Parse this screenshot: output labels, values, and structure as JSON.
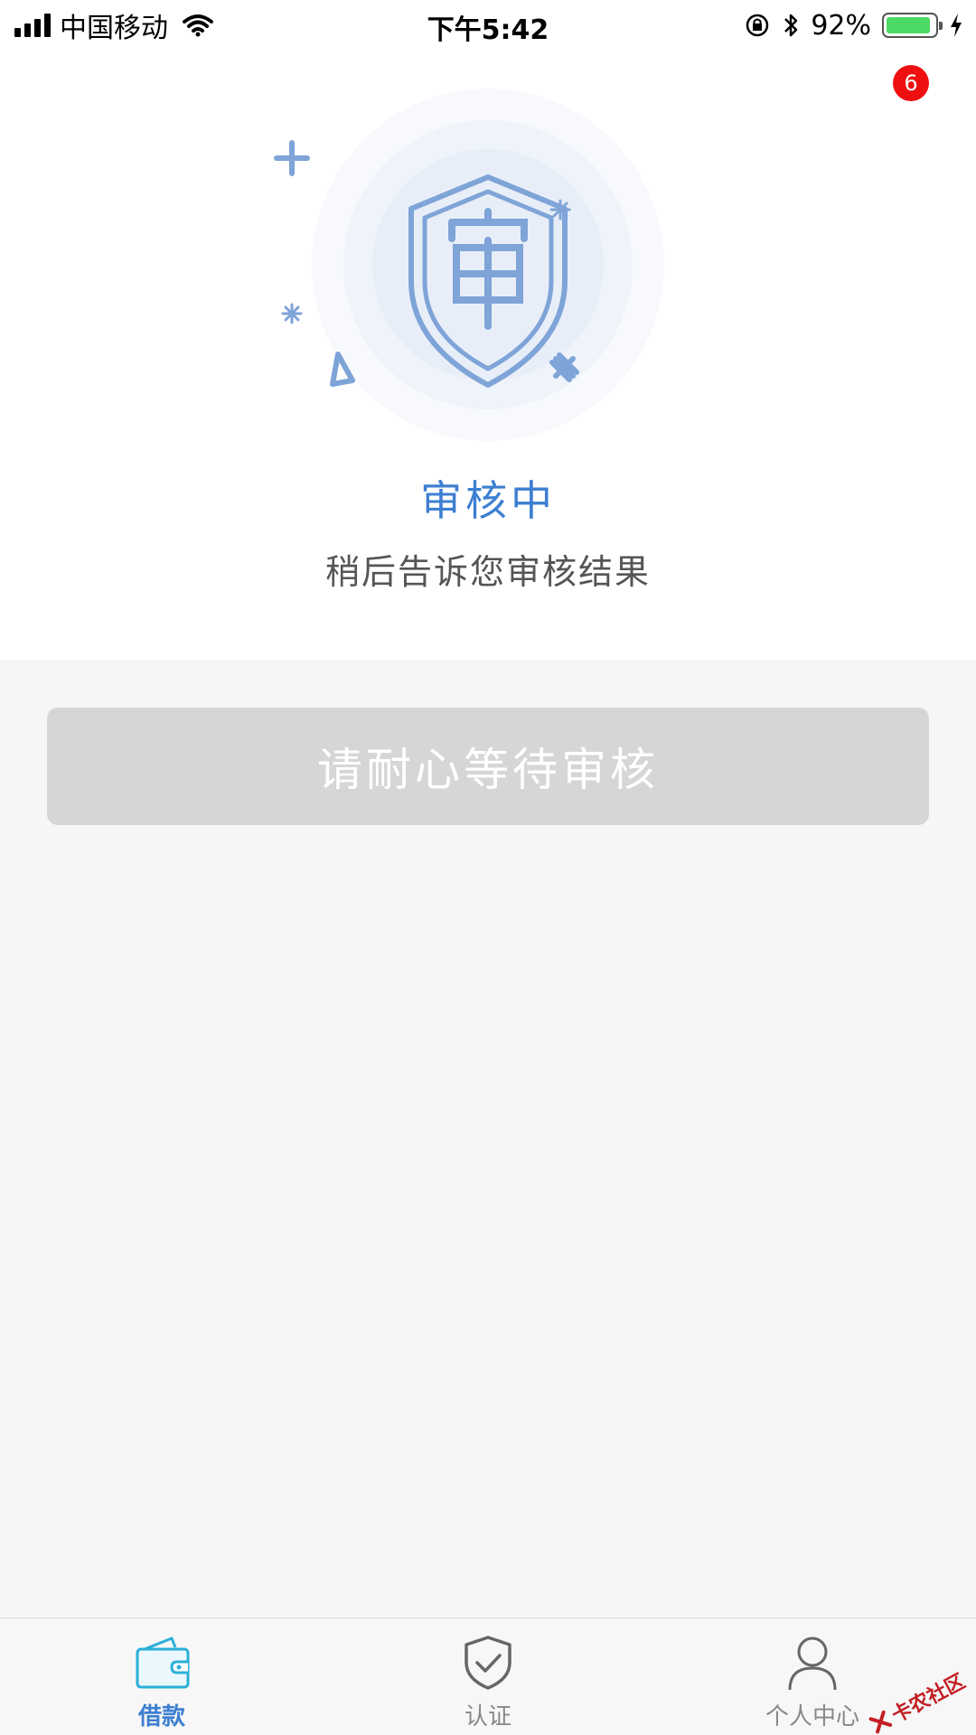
{
  "status_bar": {
    "carrier": "中国移动",
    "time": "下午5:42",
    "battery_percent": "92%",
    "battery_level": 0.92
  },
  "notification": {
    "count": "6",
    "color": "#ee1010"
  },
  "review": {
    "title": "审核中",
    "subtitle": "稍后告诉您审核结果",
    "icon": "shield-review-icon",
    "accent_color": "#3d7fd1"
  },
  "action": {
    "wait_label": "请耐心等待审核"
  },
  "tabs": [
    {
      "label": "借款",
      "icon": "wallet-icon",
      "active": true
    },
    {
      "label": "认证",
      "icon": "shield-check-icon",
      "active": false
    },
    {
      "label": "个人中心",
      "icon": "user-icon",
      "active": false
    }
  ],
  "watermark": {
    "text": "卡农社区"
  }
}
